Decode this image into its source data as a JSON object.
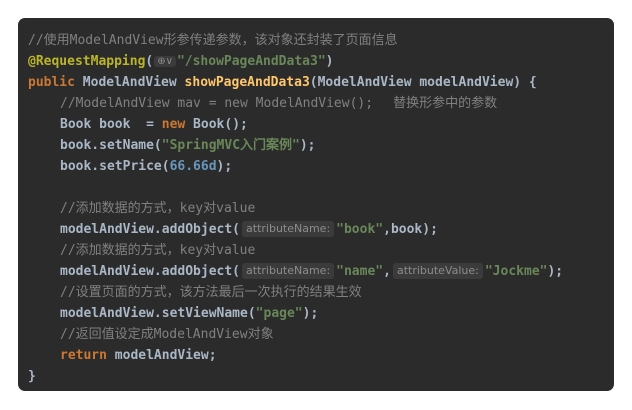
{
  "code": {
    "l1_comment": "//使用ModelAndView形参传递参数，该对象还封装了页面信息",
    "l2_annotation": "@RequestMapping",
    "l2_open": "(",
    "l2_hint_icon": "⊕∨",
    "l2_path": "\"/showPageAndData3\"",
    "l2_close": ")",
    "l3_kw": "public",
    "l3_type": " ModelAndView ",
    "l3_method": "showPageAndData3",
    "l3_params": "(ModelAndView modelAndView) {",
    "l4_comment": "//ModelAndView mav = new ModelAndView();",
    "l4_comment2": "替换形参中的参数",
    "l5_decl": "Book book  = ",
    "l5_new": "new",
    "l5_rest": " Book();",
    "l6_call": "book.setName(",
    "l6_str": "\"SpringMVC入门案例\"",
    "l6_end": ");",
    "l7_call": "book.setPrice(",
    "l7_num": "66.66d",
    "l7_end": ");",
    "l9_comment": "//添加数据的方式，key对value",
    "l10_call": "modelAndView.addObject(",
    "l10_hint": "attributeName:",
    "l10_str": "\"book\"",
    "l10_end": ",book);",
    "l11_comment": "//添加数据的方式，key对value",
    "l12_call": "modelAndView.addObject(",
    "l12_hint1": "attributeName:",
    "l12_str1": "\"name\"",
    "l12_comma": ",",
    "l12_hint2": "attributeValue:",
    "l12_str2": "\"Jockme\"",
    "l12_end": ");",
    "l13_comment": "//设置页面的方式，该方法最后一次执行的结果生效",
    "l14_call": "modelAndView.setViewName(",
    "l14_str": "\"page\"",
    "l14_end": ");",
    "l15_comment": "//返回值设定成ModelAndView对象",
    "l16_kw": "return",
    "l16_rest": " modelAndView;",
    "l17_brace": "}"
  },
  "colors": {
    "background": "#2b2b2b",
    "keyword": "#cc7832",
    "string": "#6a8759",
    "comment": "#808080",
    "annotation": "#bbb529",
    "method": "#ffc66d",
    "number": "#6897bb",
    "text": "#a9b7c6"
  }
}
